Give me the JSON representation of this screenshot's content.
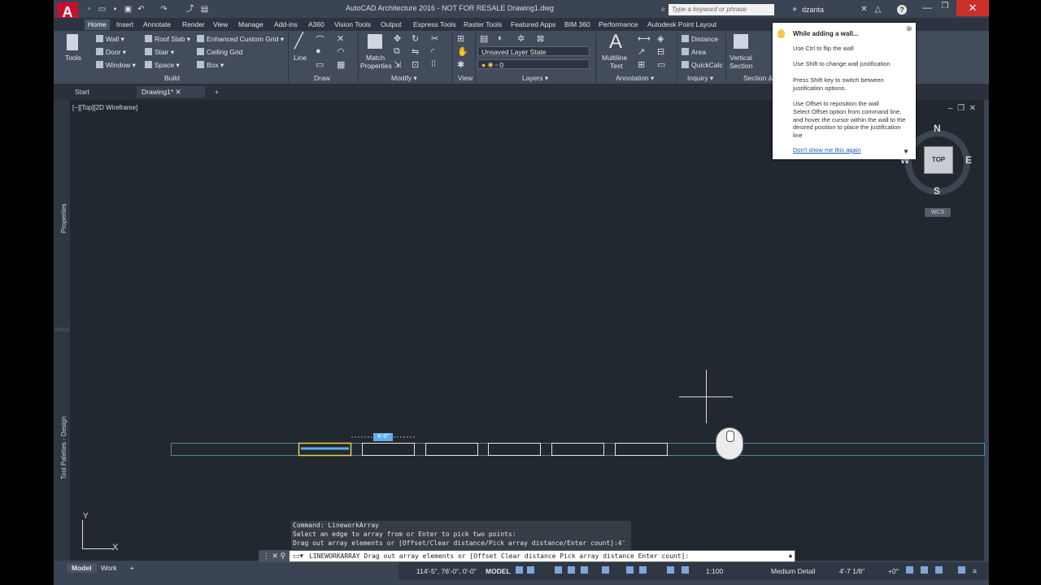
{
  "window": {
    "title": "AutoCAD Architecture 2016 - NOT FOR RESALE    Drawing1.dwg",
    "logo": "A",
    "minimize": "—",
    "maximize": "❐",
    "close": "✕"
  },
  "search": {
    "placeholder": "Type a keyword or phrase"
  },
  "user": {
    "name": "dzanta"
  },
  "ribbon_tabs": [
    "Home",
    "Insert",
    "Annotate",
    "Render",
    "View",
    "Manage",
    "Add-ins",
    "A360",
    "Vision Tools",
    "Output",
    "Express Tools",
    "Raster Tools",
    "Featured Apps",
    "BIM 360",
    "Performance",
    "Autodesk Point Layout"
  ],
  "ribbon": {
    "build": {
      "title": "Build",
      "tools": "Tools",
      "wall": "Wall",
      "door": "Door",
      "window": "Window",
      "roof_slab": "Roof Slab",
      "stair": "Stair",
      "space": "Space",
      "enhanced_grid": "Enhanced Custom Grid",
      "ceiling_grid": "Ceiling Grid",
      "box": "Box"
    },
    "draw": {
      "title": "Draw",
      "line": "Line"
    },
    "modify": {
      "title": "Modify",
      "match": "Match",
      "properties": "Properties"
    },
    "view": {
      "title": "View"
    },
    "layers": {
      "title": "Layers",
      "layer_state": "Unsaved Layer State",
      "current_layer": "0"
    },
    "annotation": {
      "title": "Annotation",
      "multiline": "Multiline",
      "text": "Text"
    },
    "inquiry": {
      "title": "Inquiry",
      "distance": "Distance",
      "area": "Area",
      "quickcalc": "QuickCalc"
    },
    "section": {
      "title": "Section &",
      "vertical": "Vertical",
      "section": "Section"
    }
  },
  "doc_tabs": [
    "Start",
    "Drawing1*"
  ],
  "viewport": {
    "label": "[−][Top][2D Wireframe]",
    "side_properties": "Properties",
    "side_tool_palettes": "Tool Palettes - Design"
  },
  "viewcube": {
    "n": "N",
    "s": "S",
    "e": "E",
    "w": "W",
    "face": "TOP",
    "wcs": "WCS"
  },
  "tooltip": {
    "title": "While adding a wall...",
    "line1": "Use Ctrl to flip the wall",
    "line2": "Use Shift to change wall justification",
    "line3": "Press Shift key to switch between justification options.",
    "line4": "Use Offset to reposition the wall",
    "line5": "Select Offset option from command line, and hover the cursor within the wall to the desired position to place the justification line",
    "link": "Don't show me this again"
  },
  "drawing": {
    "dim_label": "4'-0\""
  },
  "ucs": {
    "x": "X",
    "y": "Y"
  },
  "command": {
    "history": [
      "Command: LineworkArray",
      "Select an edge to array from or Enter to pick two points:",
      "Drag out array elements or [Offset/Clear distance/Pick array distance/Enter count]:4'"
    ],
    "current": "LINEWORKARRAY Drag out array elements or [Offset Clear distance Pick array distance Enter count]:"
  },
  "layout_tabs": [
    "Model",
    "Work",
    "+"
  ],
  "status": {
    "coords": "114'-5\", 76'-0\", 0'-0\"",
    "model": "MODEL",
    "scale": "1:100",
    "detail": "Medium Detail",
    "elevation": "4'-7 1/8\"",
    "angle": "+0\""
  },
  "colors": {
    "accent": "#c8102e",
    "viewport_bg": "#212830",
    "ribbon_bg": "#434c5b",
    "selection": "#e8d14a"
  }
}
